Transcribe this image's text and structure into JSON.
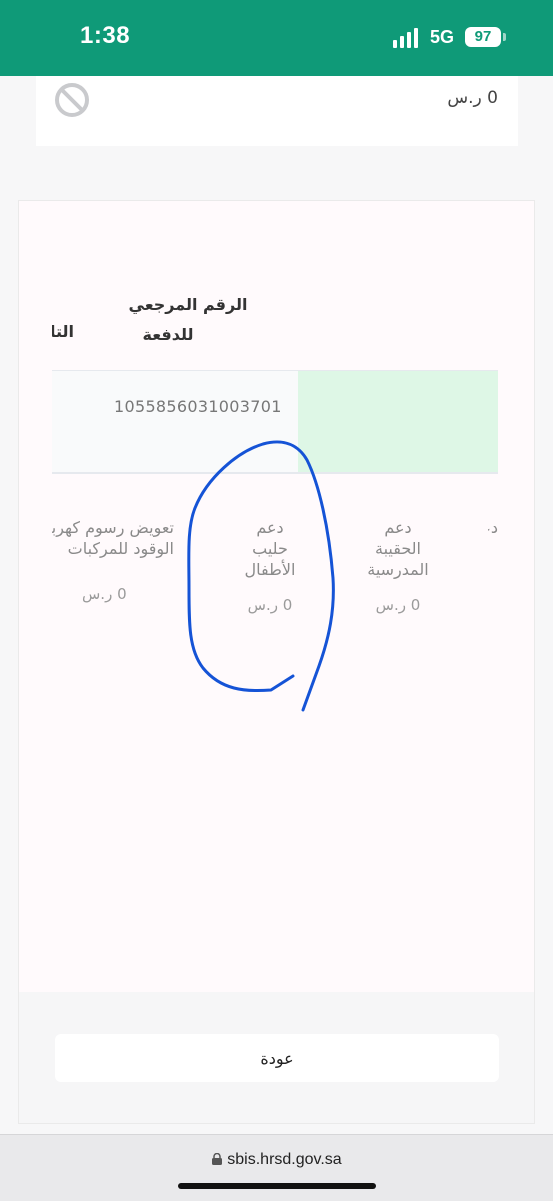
{
  "status_bar": {
    "time": "1:38",
    "network": "5G",
    "battery": "97",
    "colors": {
      "background": "#0f9a78"
    }
  },
  "top_card": {
    "amount": "0 ر.س",
    "icon": "ban-icon"
  },
  "payment_table": {
    "header": {
      "reference_line1": "الرقم المرجعي",
      "reference_line2": "للدفعة",
      "next_header_partial": "التاريخ"
    },
    "row": {
      "reference_value": "1055856031003701"
    }
  },
  "benefits": [
    {
      "label_lines": [
        "دعم",
        "الحقيبة",
        "المدرسية"
      ],
      "amount": "0 ر.س"
    },
    {
      "label_lines": [
        "دعم",
        "حليب",
        "الأطفال"
      ],
      "amount": "0 ر.س"
    },
    {
      "label_lines": [
        "تعويض رسوم كهرباء",
        "الوقود للمركبات"
      ],
      "amount": "0 ر.س"
    }
  ],
  "benefit_partial_right": "دعم",
  "footer": {
    "back_label": "عودة"
  },
  "browser": {
    "url": "sbis.hrsd.gov.sa"
  }
}
